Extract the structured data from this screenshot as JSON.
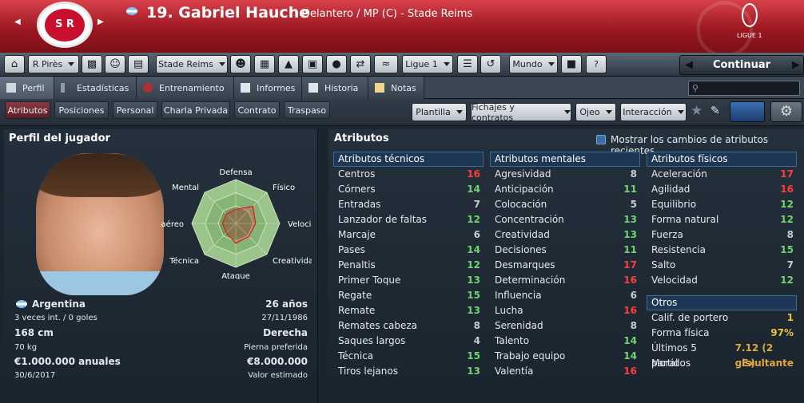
{
  "header": {
    "club_crest": "S R",
    "title": "19. Gabriel Hauche",
    "subtitle": "Delantero / MP (C) - Stade Reims",
    "league_logo_text": "LIGUE 1"
  },
  "toolbar": {
    "manager": "R Pirès",
    "club": "Stade Reims",
    "league": "Ligue 1",
    "world": "Mundo",
    "continue": "Continuar",
    "help": "?"
  },
  "tabs": [
    {
      "label": "Perfil"
    },
    {
      "label": "Estadísticas"
    },
    {
      "label": "Entrenamiento"
    },
    {
      "label": "Informes"
    },
    {
      "label": "Historia"
    },
    {
      "label": "Notas"
    }
  ],
  "subnav": {
    "items": [
      "Atributos",
      "Posiciones",
      "Personal",
      "Charla Privada",
      "Contrato",
      "Traspaso"
    ],
    "dropdowns": [
      "Plantilla",
      "Fichajes y contratos",
      "Ojeo",
      "Interacción"
    ]
  },
  "profile": {
    "title": "Perfil del jugador",
    "radar_labels": [
      "Defensa",
      "Físico",
      "Velocidad",
      "Creatividad",
      "Ataque",
      "Técnica",
      "Juego aéreo",
      "Mental"
    ],
    "radar_values": [
      0.32,
      0.55,
      0.45,
      0.42,
      0.45,
      0.3,
      0.3,
      0.3
    ],
    "nationality": "Argentina",
    "caps": "3 veces int. / 0 goles",
    "height": "168 cm",
    "weight": "70 kg",
    "salary": "€1.000.000 anuales",
    "contract_end": "30/6/2017",
    "age": "26 años",
    "dob": "27/11/1986",
    "foot": "Derecha",
    "foot_label": "Pierna preferida",
    "value": "€8.000.000",
    "value_label": "Valor estimado"
  },
  "attributes": {
    "title": "Atributos",
    "toggle_label": "Mostrar los cambios de atributos recientes",
    "technical": {
      "header": "Atributos técnicos",
      "rows": [
        {
          "name": "Centros",
          "value": "16",
          "c": "r"
        },
        {
          "name": "Córners",
          "value": "14",
          "c": "g"
        },
        {
          "name": "Entradas",
          "value": "7",
          "c": "w"
        },
        {
          "name": "Lanzador de faltas",
          "value": "12",
          "c": "g"
        },
        {
          "name": "Marcaje",
          "value": "6",
          "c": "w"
        },
        {
          "name": "Pases",
          "value": "14",
          "c": "g"
        },
        {
          "name": "Penaltis",
          "value": "12",
          "c": "g"
        },
        {
          "name": "Primer Toque",
          "value": "13",
          "c": "g"
        },
        {
          "name": "Regate",
          "value": "15",
          "c": "g"
        },
        {
          "name": "Remate",
          "value": "13",
          "c": "g"
        },
        {
          "name": "Remates cabeza",
          "value": "8",
          "c": "w"
        },
        {
          "name": "Saques largos",
          "value": "4",
          "c": "w"
        },
        {
          "name": "Técnica",
          "value": "15",
          "c": "g"
        },
        {
          "name": "Tiros lejanos",
          "value": "13",
          "c": "g"
        }
      ]
    },
    "mental": {
      "header": "Atributos mentales",
      "rows": [
        {
          "name": "Agresividad",
          "value": "8",
          "c": "w"
        },
        {
          "name": "Anticipación",
          "value": "11",
          "c": "g"
        },
        {
          "name": "Colocación",
          "value": "5",
          "c": "w"
        },
        {
          "name": "Concentración",
          "value": "13",
          "c": "g"
        },
        {
          "name": "Creatividad",
          "value": "13",
          "c": "g"
        },
        {
          "name": "Decisiones",
          "value": "11",
          "c": "g"
        },
        {
          "name": "Desmarques",
          "value": "17",
          "c": "r"
        },
        {
          "name": "Determinación",
          "value": "16",
          "c": "r"
        },
        {
          "name": "Influencia",
          "value": "6",
          "c": "w"
        },
        {
          "name": "Lucha",
          "value": "16",
          "c": "r"
        },
        {
          "name": "Serenidad",
          "value": "8",
          "c": "w"
        },
        {
          "name": "Talento",
          "value": "14",
          "c": "g"
        },
        {
          "name": "Trabajo equipo",
          "value": "14",
          "c": "g"
        },
        {
          "name": "Valentía",
          "value": "16",
          "c": "r"
        }
      ]
    },
    "physical": {
      "header": "Atributos físicos",
      "rows": [
        {
          "name": "Aceleración",
          "value": "17",
          "c": "r"
        },
        {
          "name": "Agilidad",
          "value": "16",
          "c": "r"
        },
        {
          "name": "Equilibrio",
          "value": "12",
          "c": "g"
        },
        {
          "name": "Forma natural",
          "value": "12",
          "c": "g"
        },
        {
          "name": "Fuerza",
          "value": "8",
          "c": "w"
        },
        {
          "name": "Resistencia",
          "value": "15",
          "c": "g"
        },
        {
          "name": "Salto",
          "value": "7",
          "c": "w"
        },
        {
          "name": "Velocidad",
          "value": "12",
          "c": "g"
        }
      ]
    },
    "other": {
      "header": "Otros",
      "rows": [
        {
          "name": "Calif. de portero",
          "value": "1",
          "c": "y"
        },
        {
          "name": "Forma física",
          "value": "97%",
          "c": "y"
        },
        {
          "name": "Últimos 5 partidos",
          "value": "7.12 (2 gls)",
          "c": "o"
        },
        {
          "name": "Moral",
          "value": "Exultante",
          "c": "o"
        }
      ]
    }
  }
}
